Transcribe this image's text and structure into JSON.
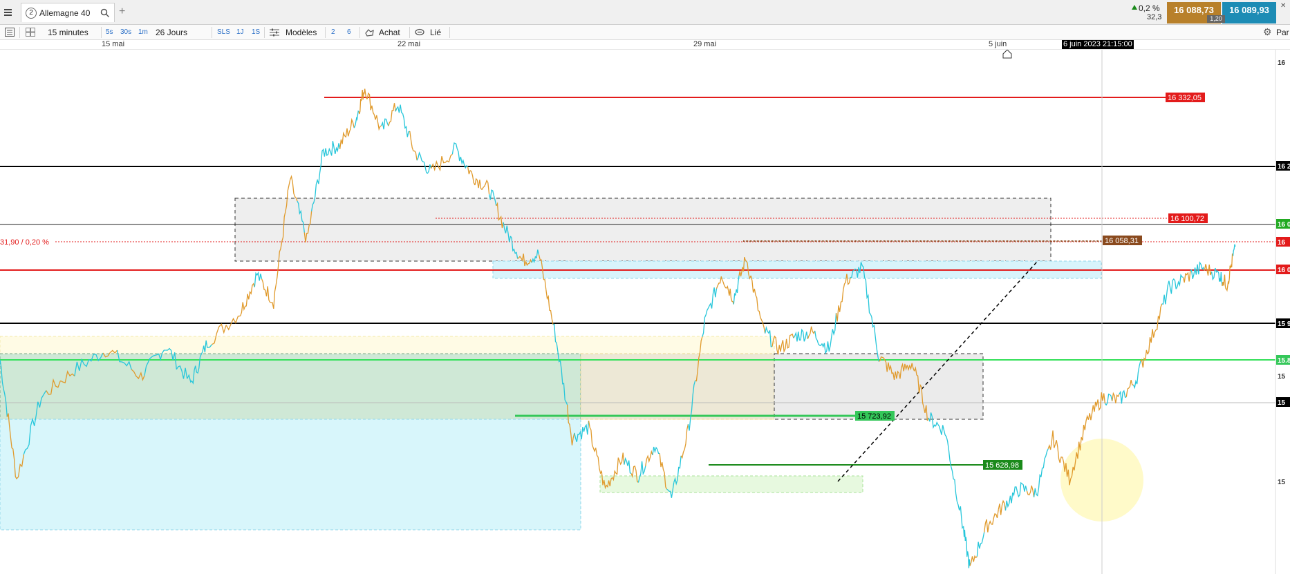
{
  "header": {
    "tab_number": "2",
    "tab_title": "Allemagne 40",
    "add_label": "+",
    "change_pct": "0,2 %",
    "change_pts": "32,3",
    "bid": "16 088,73",
    "ask": "16 089,93",
    "spread": "1,20"
  },
  "toolbar": {
    "timeframe": "15 minutes",
    "period": "26 Jours",
    "t5s": "5s",
    "t30s": "30s",
    "t1m": "1m",
    "sls": "SLS",
    "j1": "1J",
    "s1": "1S",
    "models": "Modèles",
    "n2": "2",
    "n6": "6",
    "buy": "Achat",
    "link": "Lié",
    "settings": "Par"
  },
  "dates": {
    "d1": "15 mai",
    "d2": "22 mai",
    "d3": "29 mai",
    "d4": "5 juin",
    "cursor": "6 juin 2023 21:15:00"
  },
  "chart_data": {
    "type": "line",
    "instrument": "Allemagne 40",
    "timeframe": "15 minutes",
    "x_labels": [
      "15 mai",
      "22 mai",
      "29 mai",
      "5 juin"
    ],
    "y_range": [
      15620,
      16390
    ],
    "close_path": [
      [
        0,
        15935
      ],
      [
        0.02,
        15760
      ],
      [
        0.05,
        15880
      ],
      [
        0.09,
        15920
      ],
      [
        0.13,
        15950
      ],
      [
        0.17,
        15910
      ],
      [
        0.2,
        15955
      ],
      [
        0.23,
        15900
      ],
      [
        0.25,
        15960
      ],
      [
        0.29,
        16005
      ],
      [
        0.31,
        16060
      ],
      [
        0.33,
        16020
      ],
      [
        0.35,
        16200
      ],
      [
        0.37,
        16110
      ],
      [
        0.39,
        16240
      ],
      [
        0.41,
        16250
      ],
      [
        0.43,
        16290
      ],
      [
        0.44,
        16335
      ],
      [
        0.46,
        16270
      ],
      [
        0.48,
        16310
      ],
      [
        0.5,
        16240
      ],
      [
        0.52,
        16210
      ],
      [
        0.55,
        16245
      ],
      [
        0.57,
        16205
      ],
      [
        0.59,
        16185
      ],
      [
        0.61,
        16125
      ],
      [
        0.63,
        16080
      ],
      [
        0.65,
        16090
      ],
      [
        0.67,
        15970
      ],
      [
        0.69,
        15820
      ],
      [
        0.71,
        15835
      ],
      [
        0.73,
        15745
      ],
      [
        0.75,
        15790
      ],
      [
        0.77,
        15765
      ],
      [
        0.79,
        15810
      ],
      [
        0.81,
        15730
      ],
      [
        0.83,
        15830
      ],
      [
        0.85,
        15990
      ],
      [
        0.87,
        16060
      ],
      [
        0.885,
        16025
      ],
      [
        0.9,
        16085
      ],
      [
        0.92,
        15980
      ],
      [
        0.94,
        15950
      ],
      [
        0.96,
        15970
      ],
      [
        0.98,
        15975
      ],
      [
        1.0,
        15950
      ],
      [
        1.02,
        16050
      ],
      [
        1.04,
        16070
      ],
      [
        1.06,
        15940
      ],
      [
        1.08,
        15910
      ],
      [
        1.1,
        15930
      ],
      [
        1.12,
        15850
      ],
      [
        1.14,
        15830
      ],
      [
        1.16,
        15700
      ],
      [
        1.17,
        15628
      ],
      [
        1.19,
        15690
      ],
      [
        1.21,
        15720
      ],
      [
        1.23,
        15745
      ],
      [
        1.25,
        15740
      ],
      [
        1.27,
        15820
      ],
      [
        1.29,
        15760
      ],
      [
        1.31,
        15840
      ],
      [
        1.33,
        15880
      ],
      [
        1.35,
        15875
      ],
      [
        1.37,
        15905
      ],
      [
        1.39,
        15970
      ],
      [
        1.41,
        16040
      ],
      [
        1.43,
        16055
      ],
      [
        1.45,
        16070
      ],
      [
        1.47,
        16060
      ],
      [
        1.48,
        16045
      ],
      [
        1.49,
        16101
      ]
    ],
    "levels": [
      {
        "label": "16 332,05",
        "value": 16332.05,
        "color": "#e31b1b"
      },
      {
        "label": "16 100,72",
        "value": 16100.72,
        "color": "#e31b1b"
      },
      {
        "label": "16 058,31",
        "value": 16058.31,
        "color": "#8a4a1e"
      },
      {
        "label": "15 723,92",
        "value": 15723.92,
        "color": "#34c759"
      },
      {
        "label": "15 628,98",
        "value": 15628.98,
        "color": "#1a8a1a"
      }
    ],
    "pct_label": "31,90 / 0,20 %",
    "right_tags": [
      {
        "text": "16",
        "color": "#ffffff",
        "bg": "#ffffff",
        "fg": "#333333"
      },
      {
        "text": "16 2",
        "bg": "#000000",
        "fg": "#ffffff"
      },
      {
        "text": "16 0",
        "bg": "#22aa22",
        "fg": "#ffffff"
      },
      {
        "text": "16",
        "bg": "#e31b1b",
        "fg": "#ffffff"
      },
      {
        "text": "16 0",
        "bg": "#e31b1b",
        "fg": "#ffffff"
      },
      {
        "text": "15 9",
        "bg": "#000000",
        "fg": "#ffffff"
      },
      {
        "text": "15.8",
        "bg": "#34c759",
        "fg": "#ffffff"
      },
      {
        "text": "15",
        "bg": "#ffffff",
        "fg": "#333333"
      },
      {
        "text": "15",
        "bg": "#000000",
        "fg": "#ffffff"
      },
      {
        "text": "15",
        "bg": "#ffffff",
        "fg": "#333333"
      }
    ],
    "grid": false,
    "line_colors": [
      "#26c6da",
      "#e09a2c"
    ]
  }
}
